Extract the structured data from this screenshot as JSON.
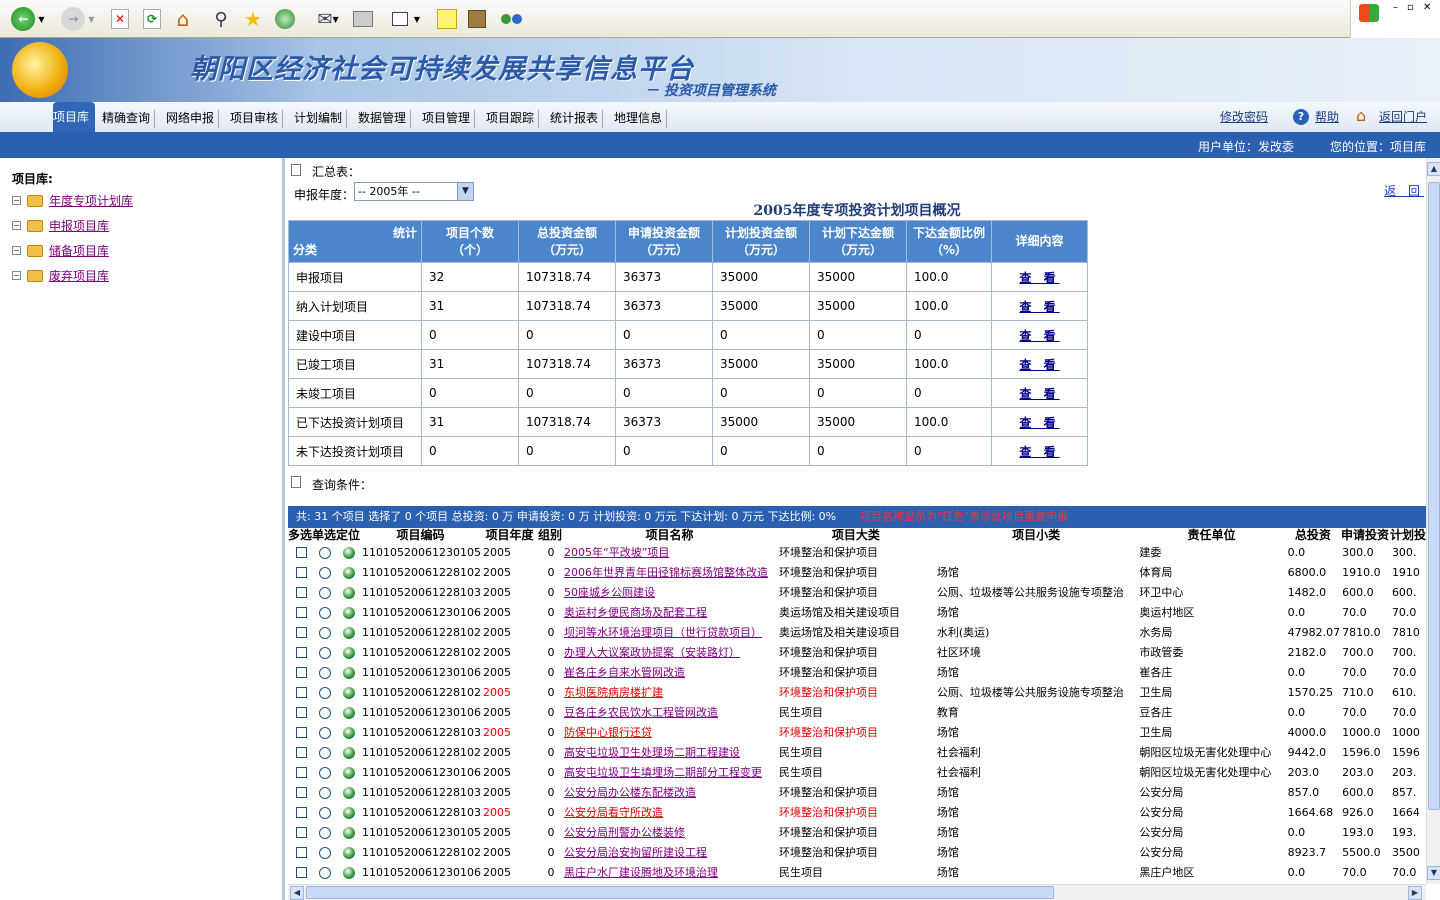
{
  "browser": {
    "toolbar_icons": [
      "back-icon",
      "forward-icon",
      "stop-icon",
      "refresh-icon",
      "home-icon",
      "search-icon",
      "favorites-icon",
      "history-icon",
      "mail-icon",
      "print-icon",
      "edit-icon",
      "note-icon",
      "research-icon",
      "messenger-icon"
    ]
  },
  "header": {
    "title": "朝阳区经济社会可持续发展共享信息平台",
    "subtitle": "－ 投资项目管理系统"
  },
  "nav": {
    "items": [
      "项目库",
      "精确查询",
      "网络申报",
      "项目审核",
      "计划编制",
      "数据管理",
      "项目管理",
      "项目跟踪",
      "统计报表",
      "地理信息"
    ],
    "right": {
      "change_pw": "修改密码",
      "help": "帮助",
      "portal": "返回门户"
    }
  },
  "infobar": {
    "unit": "用户单位：发改委",
    "location": "您的位置：项目库"
  },
  "sidebar": {
    "title": "项目库:",
    "items": [
      "年度专项计划库",
      "申报项目库",
      "储备项目库",
      "废弃项目库"
    ]
  },
  "summary_section": {
    "label": "汇总表：",
    "year_label": "申报年度：",
    "year_value": "-- 2005年 --",
    "back": "返 回",
    "title": "2005年度专项投资计划项目概况",
    "corner_top": "统计",
    "corner_bottom": "分类",
    "headers": [
      [
        "项目个数",
        "（个）"
      ],
      [
        "总投资金额",
        "（万元）"
      ],
      [
        "申请投资金额",
        "（万元）"
      ],
      [
        "计划投资金额",
        "（万元）"
      ],
      [
        "计划下达金额",
        "（万元）"
      ],
      [
        "下达金额比例",
        "（%）"
      ],
      [
        "详细内容",
        ""
      ]
    ],
    "view_label": "查 看",
    "rows": [
      [
        "申报项目",
        "32",
        "107318.74",
        "36373",
        "35000",
        "35000",
        "100.0"
      ],
      [
        "纳入计划项目",
        "31",
        "107318.74",
        "36373",
        "35000",
        "35000",
        "100.0"
      ],
      [
        "建设中项目",
        "0",
        "0",
        " 0",
        "0",
        "0",
        "0"
      ],
      [
        "已竣工项目",
        "31",
        "107318.74",
        "36373",
        "35000",
        "35000",
        "100.0"
      ],
      [
        "未竣工项目",
        "0",
        "0",
        " 0",
        "0",
        "0",
        "0"
      ],
      [
        "已下达投资计划项目",
        "31",
        "107318.74",
        "36373",
        "35000",
        "35000",
        "100.0"
      ],
      [
        "未下达投资计划项目",
        "0",
        "0",
        " 0",
        "0",
        "0",
        "0"
      ]
    ]
  },
  "query_label": "查询条件：",
  "status": {
    "text": "共: 31 个项目    选择了 0 个项目 总投资: 0 万 申请投资: 0 万 计划投资: 0 万元 下达计划: 0 万元 下达比例: 0%",
    "note": "项目名称显示为\"红色\"表示此项目重复申报"
  },
  "list": {
    "headers": [
      "多选",
      "单选",
      "定位",
      "项目编码",
      "项目年度",
      "组别",
      "项目名称",
      "项目大类",
      "项目小类",
      "责任单位",
      "总投资",
      "申请投资",
      "计划投"
    ],
    "rows": [
      {
        "code": "11010520061230105",
        "year": "2005",
        "group": "0",
        "name": "2005年“平改坡”项目",
        "cat": "环境整治和保护项目",
        "sub": "",
        "unit": "建委",
        "total": "0.0",
        "apply": "300.0",
        "plan": "300.",
        "dup": false
      },
      {
        "code": "11010520061228102",
        "year": "2005",
        "group": "0",
        "name": "2006年世界青年田径锦标赛场馆整体改造",
        "cat": "环境整治和保护项目",
        "sub": "场馆",
        "unit": "体育局",
        "total": "6800.0",
        "apply": "1910.0",
        "plan": "1910",
        "dup": false
      },
      {
        "code": "11010520061228103",
        "year": "2005",
        "group": "0",
        "name": "50座城乡公厕建设",
        "cat": "环境整治和保护项目",
        "sub": "公厕、垃圾楼等公共服务设施专项整治",
        "unit": "环卫中心",
        "total": "1482.0",
        "apply": "600.0",
        "plan": "600.",
        "dup": false
      },
      {
        "code": "11010520061230106",
        "year": "2005",
        "group": "0",
        "name": "奥运村乡便民商场及配套工程",
        "cat": "奥运场馆及相关建设项目",
        "sub": "场馆",
        "unit": "奥运村地区",
        "total": "0.0",
        "apply": "70.0",
        "plan": "70.0",
        "dup": false
      },
      {
        "code": "11010520061228102",
        "year": "2005",
        "group": "0",
        "name": "坝河等水环境治理项目（世行贷款项目）",
        "cat": "奥运场馆及相关建设项目",
        "sub": "水利(奥运)",
        "unit": "水务局",
        "total": "47982.07",
        "apply": "7810.0",
        "plan": "7810",
        "dup": false
      },
      {
        "code": "11010520061228102",
        "year": "2005",
        "group": "0",
        "name": "办理人大议案政协提案（安装路灯）",
        "cat": "环境整治和保护项目",
        "sub": "社区环境",
        "unit": "市政管委",
        "total": "2182.0",
        "apply": "700.0",
        "plan": "700.",
        "dup": false
      },
      {
        "code": "11010520061230106",
        "year": "2005",
        "group": "0",
        "name": "崔各庄乡自来水管网改造",
        "cat": "环境整治和保护项目",
        "sub": "场馆",
        "unit": "崔各庄",
        "total": "0.0",
        "apply": "70.0",
        "plan": "70.0",
        "dup": false
      },
      {
        "code": "11010520061228102",
        "year": "2005",
        "group": "0",
        "name": "东坝医院病房楼扩建",
        "cat": "环境整治和保护项目",
        "sub": "公厕、垃圾楼等公共服务设施专项整治",
        "unit": "卫生局",
        "total": "1570.25",
        "apply": "710.0",
        "plan": "610.",
        "dup": true
      },
      {
        "code": "11010520061230106",
        "year": "2005",
        "group": "0",
        "name": "豆各庄乡农民饮水工程管网改造",
        "cat": "民生项目",
        "sub": "教育",
        "unit": "豆各庄",
        "total": "0.0",
        "apply": "70.0",
        "plan": "70.0",
        "dup": false
      },
      {
        "code": "11010520061228103",
        "year": "2005",
        "group": "0",
        "name": "防保中心银行还贷",
        "cat": "环境整治和保护项目",
        "sub": "场馆",
        "unit": "卫生局",
        "total": "4000.0",
        "apply": "1000.0",
        "plan": "1000",
        "dup": true
      },
      {
        "code": "11010520061228102",
        "year": "2005",
        "group": "0",
        "name": "高安屯垃圾卫生处理场二期工程建设",
        "cat": "民生项目",
        "sub": "社会福利",
        "unit": "朝阳区垃圾无害化处理中心",
        "total": "9442.0",
        "apply": "1596.0",
        "plan": "1596",
        "dup": false
      },
      {
        "code": "11010520061230106",
        "year": "2005",
        "group": "0",
        "name": "高安屯垃圾卫生填埋场二期部分工程变更",
        "cat": "民生项目",
        "sub": "社会福利",
        "unit": "朝阳区垃圾无害化处理中心",
        "total": "203.0",
        "apply": "203.0",
        "plan": "203.",
        "dup": false
      },
      {
        "code": "11010520061228103",
        "year": "2005",
        "group": "0",
        "name": "公安分局办公楼东配楼改造",
        "cat": "环境整治和保护项目",
        "sub": "场馆",
        "unit": "公安分局",
        "total": "857.0",
        "apply": "600.0",
        "plan": "857.",
        "dup": false
      },
      {
        "code": "11010520061228103",
        "year": "2005",
        "group": "0",
        "name": "公安分局看守所改造",
        "cat": "环境整治和保护项目",
        "sub": "场馆",
        "unit": "公安分局",
        "total": "1664.68",
        "apply": "926.0",
        "plan": "1664",
        "dup": true
      },
      {
        "code": "11010520061230105",
        "year": "2005",
        "group": "0",
        "name": "公安分局刑警办公楼装修",
        "cat": "环境整治和保护项目",
        "sub": "场馆",
        "unit": "公安分局",
        "total": "0.0",
        "apply": "193.0",
        "plan": "193.",
        "dup": false
      },
      {
        "code": "11010520061228102",
        "year": "2005",
        "group": "0",
        "name": "公安分局治安拘留所建设工程",
        "cat": "环境整治和保护项目",
        "sub": "场馆",
        "unit": "公安分局",
        "total": "8923.7",
        "apply": "5500.0",
        "plan": "3500",
        "dup": false
      },
      {
        "code": "11010520061230106",
        "year": "2005",
        "group": "0",
        "name": "黑庄户水厂建设腾地及环境治理",
        "cat": "民生项目",
        "sub": "场馆",
        "unit": "黑庄户地区",
        "total": "0.0",
        "apply": "70.0",
        "plan": "70.0",
        "dup": false
      }
    ]
  }
}
